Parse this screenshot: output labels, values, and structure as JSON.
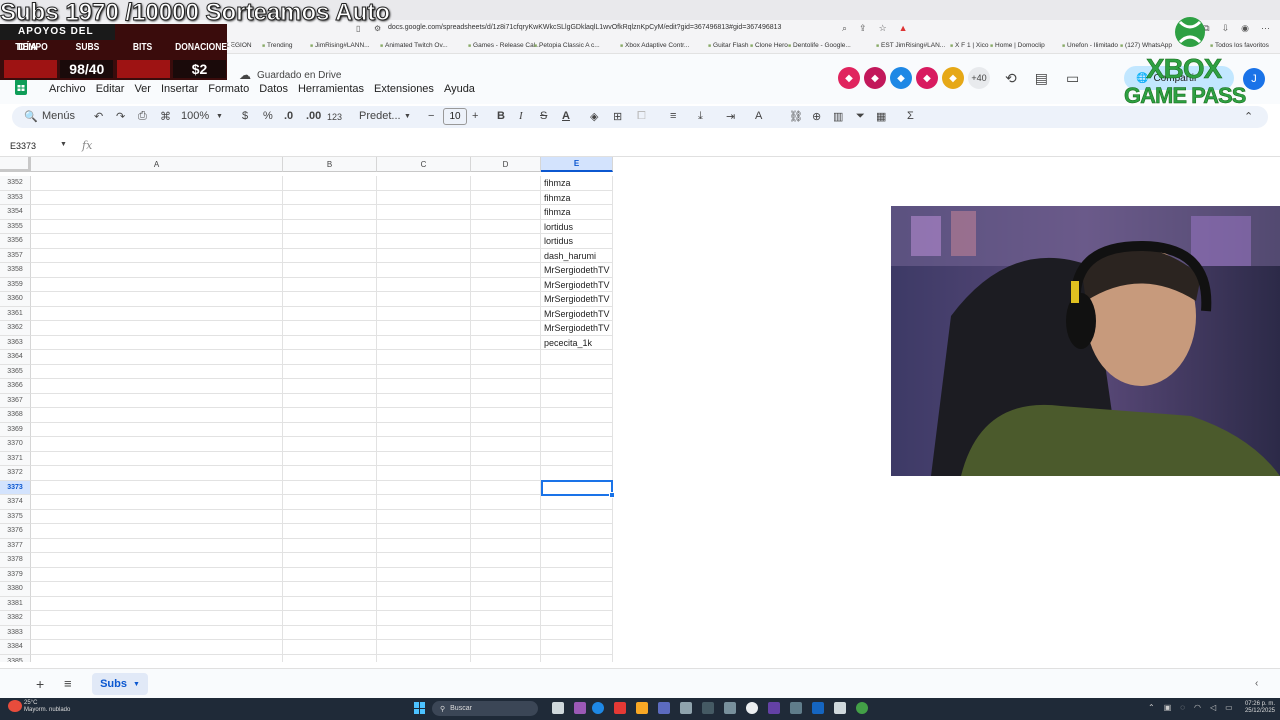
{
  "browser": {
    "url": "docs.google.com/spreadsheets/d/1z8i71cfqryKwKWkcSLlgGDklaqlL1wvOfkRqlznKpCyM/edit?gid=367496813#gid=367496813",
    "bookmarks": [
      "LEGION",
      "Trending",
      "JimRising#LANN...",
      "Animated Twitch Ov...",
      "Games - Release Cal...",
      "Petopia Classic A c...",
      "Xbox Adaptive Contr...",
      "Guitar Flash",
      "Clone Hero",
      "Dentolife - Google...",
      "EST JimRising#LAN...",
      "X F 1 | Xico",
      "Home | Domoclip",
      "Unefon - Ilimitado",
      "(127) WhatsApp",
      "Todos los favoritos"
    ]
  },
  "doc": {
    "save_status": "Guardado en Drive",
    "menu": [
      "Archivo",
      "Editar",
      "Ver",
      "Insertar",
      "Formato",
      "Datos",
      "Herramientas",
      "Extensiones",
      "Ayuda"
    ],
    "collaborators_more": "+40",
    "share_label": "Compartir",
    "profile_initial": "J"
  },
  "toolbar": {
    "menus_label": "Menús",
    "zoom": "100%",
    "currency": "$",
    "percent": "%",
    "dec_less": ".0",
    "dec_more": ".00",
    "number_format": "123",
    "font": "Predet...",
    "font_size": "10"
  },
  "formula_bar": {
    "name_box": "E3373",
    "fx_symbol": "fx",
    "value": ""
  },
  "grid": {
    "columns": [
      "A",
      "B",
      "C",
      "D",
      "E"
    ],
    "selected_column": "E",
    "selected_row": "3373",
    "rows": [
      {
        "n": "3352",
        "e": "fihmza"
      },
      {
        "n": "3353",
        "e": "fihmza"
      },
      {
        "n": "3354",
        "e": "fihmza"
      },
      {
        "n": "3355",
        "e": "lortidus"
      },
      {
        "n": "3356",
        "e": "lortidus"
      },
      {
        "n": "3357",
        "e": "dash_harumi"
      },
      {
        "n": "3358",
        "e": "MrSergiodethTV"
      },
      {
        "n": "3359",
        "e": "MrSergiodethTV"
      },
      {
        "n": "3360",
        "e": "MrSergiodethTV"
      },
      {
        "n": "3361",
        "e": "MrSergiodethTV"
      },
      {
        "n": "3362",
        "e": "MrSergiodethTV"
      },
      {
        "n": "3363",
        "e": "pececita_1k"
      },
      {
        "n": "3364",
        "e": ""
      },
      {
        "n": "3365",
        "e": ""
      },
      {
        "n": "3366",
        "e": ""
      },
      {
        "n": "3367",
        "e": ""
      },
      {
        "n": "3368",
        "e": ""
      },
      {
        "n": "3369",
        "e": ""
      },
      {
        "n": "3370",
        "e": ""
      },
      {
        "n": "3371",
        "e": ""
      },
      {
        "n": "3372",
        "e": ""
      },
      {
        "n": "3373",
        "e": ""
      },
      {
        "n": "3374",
        "e": ""
      },
      {
        "n": "3375",
        "e": ""
      },
      {
        "n": "3376",
        "e": ""
      },
      {
        "n": "3377",
        "e": ""
      },
      {
        "n": "3378",
        "e": ""
      },
      {
        "n": "3379",
        "e": ""
      },
      {
        "n": "3380",
        "e": ""
      },
      {
        "n": "3381",
        "e": ""
      },
      {
        "n": "3382",
        "e": ""
      },
      {
        "n": "3383",
        "e": ""
      },
      {
        "n": "3384",
        "e": ""
      },
      {
        "n": "3385",
        "e": ""
      }
    ]
  },
  "sheet_tabs": {
    "active": "Subs"
  },
  "overlay": {
    "title": "Subs 1970 /10000 Sorteamos Auto",
    "support_header": "APOYOS DEL DÍA",
    "stats": [
      {
        "label": "TIEMPO",
        "value": ""
      },
      {
        "label": "SUBS",
        "value": "98/40"
      },
      {
        "label": "BITS",
        "value": ""
      },
      {
        "label": "DONACIONES",
        "value": "$2"
      }
    ],
    "brand_line1": "XBOX",
    "brand_line2": "GAME PASS"
  },
  "taskbar": {
    "weather_temp": "25°C",
    "weather_desc": "Mayorm. nublado",
    "search": "Buscar",
    "time": "07:26 p. m.",
    "date": "25/12/2025"
  }
}
